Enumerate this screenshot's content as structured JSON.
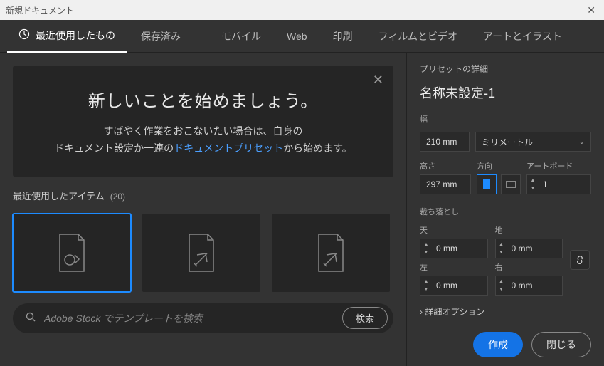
{
  "window": {
    "title": "新規ドキュメント"
  },
  "tabs": {
    "recent": "最近使用したもの",
    "saved": "保存済み",
    "mobile": "モバイル",
    "web": "Web",
    "print": "印刷",
    "film": "フィルムとビデオ",
    "art": "アートとイラスト"
  },
  "hero": {
    "title": "新しいことを始めましょう。",
    "line1": "すばやく作業をおこないたい場合は、自身の",
    "line2a": "ドキュメント設定か一連の",
    "link": "ドキュメントプリセット",
    "line2b": "から始めます。"
  },
  "recent": {
    "label": "最近使用したアイテム",
    "count": "(20)"
  },
  "search": {
    "placeholder": "Adobe Stock でテンプレートを検索",
    "button": "検索"
  },
  "preset": {
    "heading": "プリセットの詳細",
    "docname": "名称未設定-1",
    "width_label": "幅",
    "width_value": "210 mm",
    "unit": "ミリメートル",
    "height_label": "高さ",
    "height_value": "297 mm",
    "orient_label": "方向",
    "artboard_label": "アートボード",
    "artboard_value": "1",
    "bleed_label": "裁ち落とし",
    "top_label": "天",
    "bottom_label": "地",
    "left_label": "左",
    "right_label": "右",
    "bleed_top": "0 mm",
    "bleed_bottom": "0 mm",
    "bleed_left": "0 mm",
    "bleed_right": "0 mm",
    "advanced": "詳細オプション"
  },
  "buttons": {
    "create": "作成",
    "close": "閉じる"
  }
}
